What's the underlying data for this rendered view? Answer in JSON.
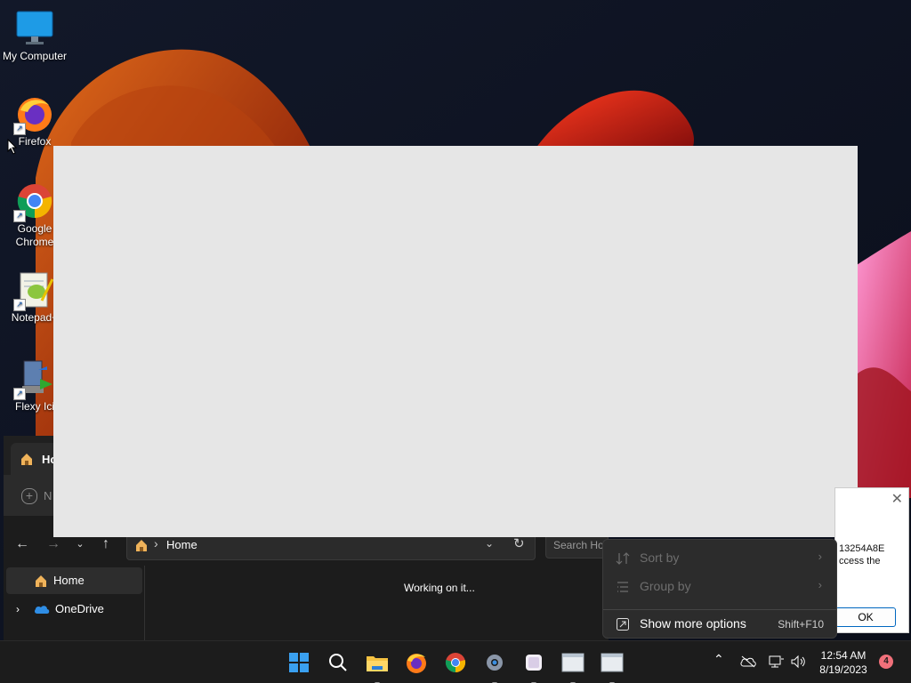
{
  "desktop": {
    "icons": [
      {
        "label": "My Computer"
      },
      {
        "label": "Firefox"
      },
      {
        "label": "Google Chrome"
      },
      {
        "label": "Notepad+"
      },
      {
        "label": "Flexy Ici"
      }
    ]
  },
  "explorer": {
    "tab_label": "Ho",
    "new_label": "N",
    "address_path": "Home",
    "search_placeholder": "Search Ho",
    "status_text": "Working on it...",
    "sidebar": [
      {
        "label": "Home"
      },
      {
        "label": "OneDrive"
      }
    ]
  },
  "dialog": {
    "line1": "13254A8E",
    "line2": "ccess the",
    "ok_label": "OK"
  },
  "context_menu": {
    "items": [
      {
        "label": "Sort by",
        "disabled": true
      },
      {
        "label": "Group by",
        "disabled": true
      },
      {
        "label": "Show more options",
        "shortcut": "Shift+F10"
      }
    ]
  },
  "taskbar": {
    "time": "12:54 AM",
    "date": "8/19/2023",
    "notification_count": "4",
    "accent": "#0078d4"
  }
}
